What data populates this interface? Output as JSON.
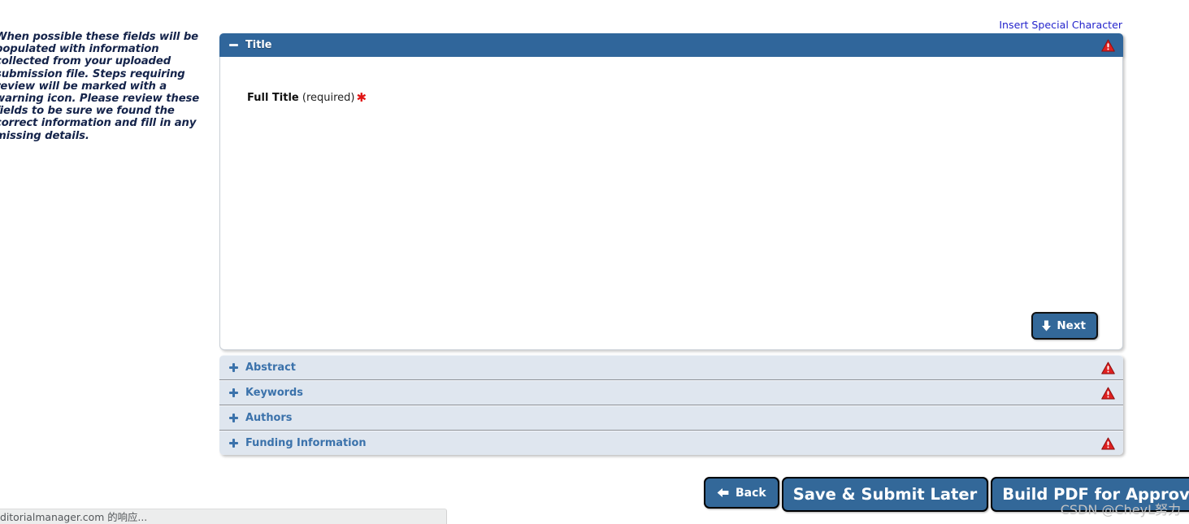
{
  "instructions": {
    "text": "When possible these fields will be populated with information collected from your uploaded submission file. Steps requiring review will be marked with a warning icon. Please review these fields to be sure we found the correct information and fill in any missing details."
  },
  "toolbar": {
    "insert_special_character": "Insert Special Character"
  },
  "open_section": {
    "title": "Title",
    "collapse_icon": "minus-icon",
    "has_warning": true,
    "field": {
      "label": "Full Title",
      "required_text": "(required)",
      "required_marker": "✱",
      "value": ""
    },
    "next_button": {
      "label": "Next",
      "icon": "arrow-down-icon"
    }
  },
  "collapsed_sections": [
    {
      "title": "Abstract",
      "has_warning": true,
      "expand_icon": "plus-icon"
    },
    {
      "title": "Keywords",
      "has_warning": true,
      "expand_icon": "plus-icon"
    },
    {
      "title": "Authors",
      "has_warning": false,
      "expand_icon": "plus-icon"
    },
    {
      "title": "Funding Information",
      "has_warning": true,
      "expand_icon": "plus-icon"
    }
  ],
  "actions": {
    "back": {
      "label": "Back",
      "icon": "arrow-left-icon"
    },
    "save_submit_later": {
      "label": "Save & Submit Later"
    },
    "build_pdf": {
      "label": "Build PDF for Approval",
      "icon": "arrow-right-icon"
    }
  },
  "browser_status": {
    "text": "ditorialmanager.com 的响应..."
  },
  "watermark": {
    "text": "CSDN @CheyL努力"
  },
  "colors": {
    "header_blue": "#30669b",
    "button_blue": "#336899",
    "section_bg": "#dfe6ef",
    "section_text": "#3b72ab",
    "link_blue": "#2424cc",
    "warning_red": "#e02020",
    "required_red": "#e11515",
    "instruction_navy": "#14234a"
  }
}
